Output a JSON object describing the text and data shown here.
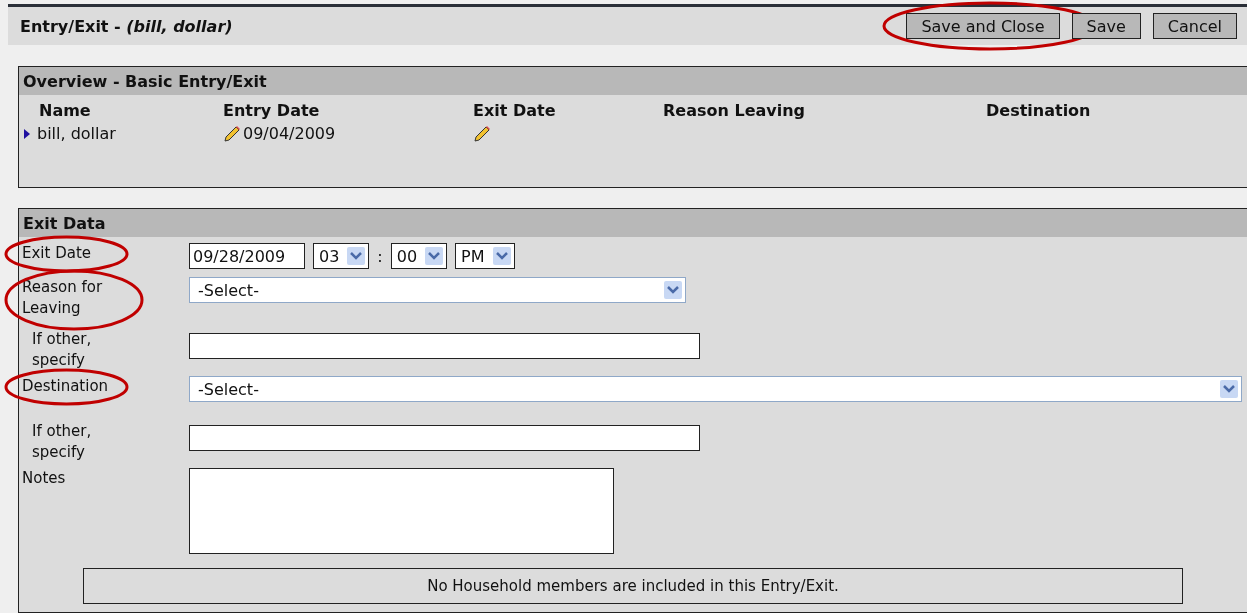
{
  "header": {
    "title": "Entry/Exit - *(bill, dollar)*"
  },
  "buttons": [
    {
      "label": "Save and Close",
      "highlighted": true
    },
    {
      "label": "Save",
      "highlighted": false
    },
    {
      "label": "Cancel",
      "highlighted": false
    }
  ],
  "overview": {
    "title": "Overview - Basic Entry/Exit",
    "columns": [
      "Name",
      "Entry Date",
      "Exit Date",
      "Reason Leaving",
      "Destination"
    ],
    "rows": [
      {
        "name": "bill, dollar",
        "entry_date": "09/04/2009"
      }
    ]
  },
  "exit_data": {
    "title": "Exit Data",
    "fields": [
      {
        "kind": "datetime",
        "label": "Exit Date",
        "highlighted": true,
        "date": "09/28/2009",
        "hour": "03",
        "separator": ":",
        "minute": "00",
        "ampm": "PM"
      },
      {
        "kind": "select",
        "label": "Reason for Leaving",
        "highlighted": true,
        "value": "-Select-"
      },
      {
        "kind": "text",
        "label": "If other, specify",
        "highlighted": false
      },
      {
        "kind": "wide-select",
        "label": "Destination",
        "highlighted": true,
        "value": "-Select-"
      },
      {
        "kind": "text",
        "label": "If other, specify",
        "highlighted": false
      },
      {
        "kind": "textarea",
        "label": "Notes",
        "highlighted": false
      }
    ]
  },
  "household_note": "No Household members are included in this Entry/Exit."
}
